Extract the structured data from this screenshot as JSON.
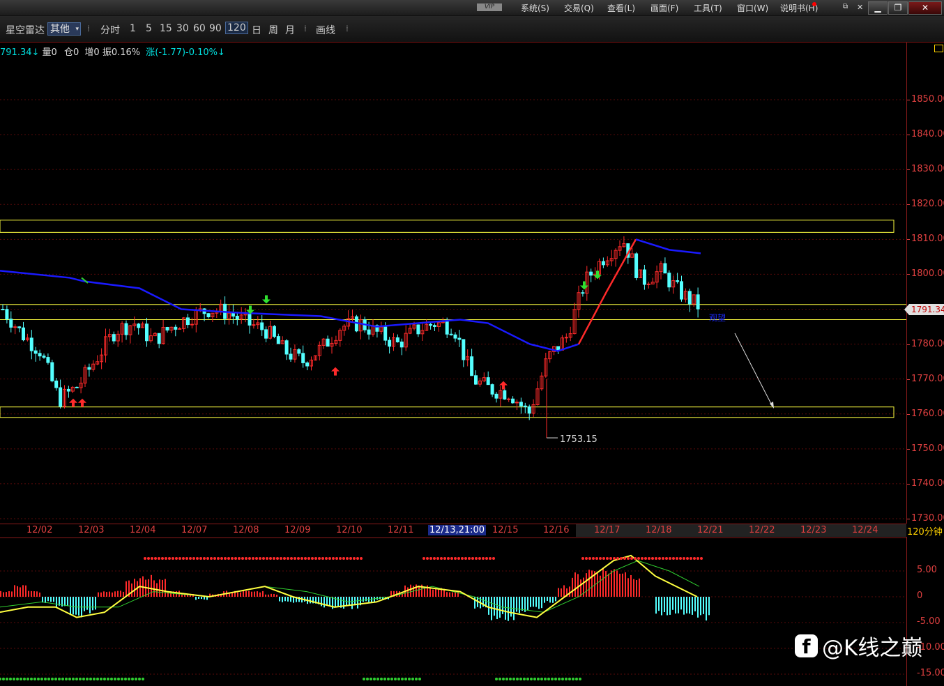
{
  "menu": [
    "系统(S)",
    "交易(Q)",
    "查看(L)",
    "画面(F)",
    "工具(T)",
    "窗口(W)",
    "说明书(H)"
  ],
  "vip": "VIP",
  "toolbar": {
    "app_name": "星空雷达",
    "select_value": "其他",
    "periods": [
      "分时",
      "1",
      "5",
      "15",
      "30",
      "60",
      "90",
      "120",
      "日",
      "周",
      "月"
    ],
    "active_period": "120",
    "draw_line": "画线"
  },
  "info": {
    "price": "791.34",
    "volume": "量0",
    "oi": "仓0",
    "inc": "增0",
    "amp": "振0.16%",
    "chg": "涨(-1.77)-0.10%"
  },
  "price_axis": [
    "1850.00",
    "1840.00",
    "1830.00",
    "1820.00",
    "1810.00",
    "1800.00",
    "1790.00",
    "1780.00",
    "1770.00",
    "1760.00",
    "1750.00",
    "1740.00",
    "1730.00"
  ],
  "last_price": "1791.34",
  "low_label": "1753.15",
  "watch_label": "观望",
  "dates": [
    "12/02",
    "12/03",
    "12/04",
    "12/07",
    "12/08",
    "12/09",
    "12/10",
    "12/11",
    "12/13,21:00",
    "12/15",
    "12/16",
    "12/17",
    "12/18",
    "12/21",
    "12/22",
    "12/23",
    "12/24"
  ],
  "period_label": "120分钟",
  "ind_axis": [
    "5.00",
    "0",
    "-5.00",
    "-10.00",
    "-15.00"
  ],
  "watermark": "@K线之巅",
  "colors": {
    "up": "#ff2a2a",
    "down": "#54ffff",
    "ma": "#1a1aff",
    "band": "#ffff40",
    "dif": "#ffff40",
    "dea": "#30d030"
  },
  "chart_data": {
    "type": "candlestick",
    "x_label_unit": "120-minute bars",
    "y_range": [
      1727,
      1857
    ],
    "closes_approx": [
      1790,
      1783,
      1778,
      1764,
      1768,
      1776,
      1784,
      1786,
      1781,
      1785,
      1788,
      1790,
      1789,
      1786,
      1784,
      1778,
      1775,
      1779,
      1785,
      1786,
      1783,
      1780,
      1784,
      1786,
      1785,
      1770,
      1767,
      1766,
      1760,
      1776,
      1782,
      1798,
      1805,
      1810,
      1798,
      1801,
      1795,
      1791
    ],
    "extreme_low": 1753.15,
    "horizontal_levels": [
      1791.34,
      1787
    ],
    "boxes": [
      [
        1812,
        1815.5
      ],
      [
        1759,
        1762
      ]
    ],
    "indicator_levels": [
      5,
      0,
      -5,
      -10,
      -15
    ]
  }
}
